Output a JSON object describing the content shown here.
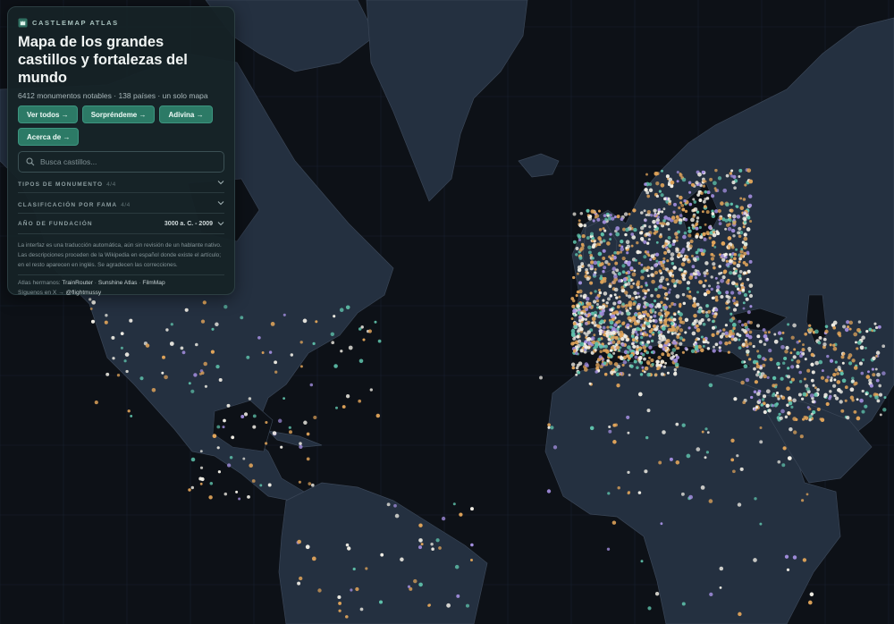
{
  "header": {
    "brand": "CASTLEMAP ATLAS",
    "title": "Mapa de los grandes castillos y fortalezas del mundo",
    "subtitle": "6412 monumentos notables · 138 países · un solo mapa"
  },
  "buttons": {
    "view_all": "Ver todos →",
    "surprise": "Sorpréndeme →",
    "guess": "Adivina →",
    "about": "Acerca de →"
  },
  "search": {
    "placeholder": "Busca castillos..."
  },
  "filters": {
    "types": {
      "label": "TIPOS DE MONUMENTO",
      "count": "4/4"
    },
    "fame": {
      "label": "CLASIFICACIÓN POR FAMA",
      "count": "4/4"
    },
    "founded": {
      "label": "AÑO DE FUNDACIÓN",
      "value": "3000 a. C. - 2009"
    }
  },
  "note": "La interfaz es una traducción automática, aún sin revisión de un hablante nativo. Las descripciones proceden de la Wikipedia en español donde existe el artículo; en el resto aparecen en inglés. Se agradecen las correcciones.",
  "footer": {
    "sister_label": "Atlas hermanos:",
    "sisters": [
      "TrainRouter",
      "Sunshine Atlas",
      "FilmMap"
    ],
    "follow_label": "Síguenos en X →",
    "handle": "@flightmussy"
  },
  "map": {
    "colors": {
      "ocean": "#0d1117",
      "land": "#243040",
      "border": "#3a4657",
      "gold": "#e0a45a",
      "violet": "#a48fe0",
      "white": "#f2efe6",
      "teal": "#5fc2ab"
    }
  }
}
